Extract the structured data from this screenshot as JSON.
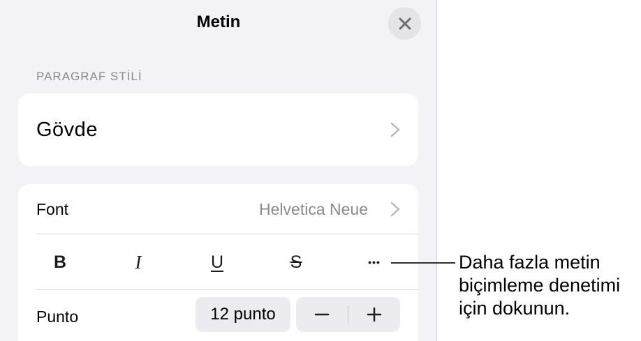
{
  "panel": {
    "title": "Metin",
    "close_icon": "close-icon"
  },
  "paragraph_style": {
    "section_label": "PARAGRAF STİLİ",
    "value": "Gövde"
  },
  "font": {
    "label": "Font",
    "value": "Helvetica Neue"
  },
  "format_buttons": {
    "bold": "B",
    "italic": "I",
    "underline": "U",
    "strikethrough": "S",
    "more": "•••"
  },
  "size": {
    "label": "Punto",
    "value": "12 punto"
  },
  "callout": {
    "line1": "Daha fazla metin",
    "line2": "biçimleme denetimi",
    "line3": "için dokunun."
  },
  "colors": {
    "panel_bg": "#f2f2f7",
    "card_bg": "#ffffff",
    "secondary_text": "#8a8a8e",
    "control_bg": "#ececf0"
  }
}
